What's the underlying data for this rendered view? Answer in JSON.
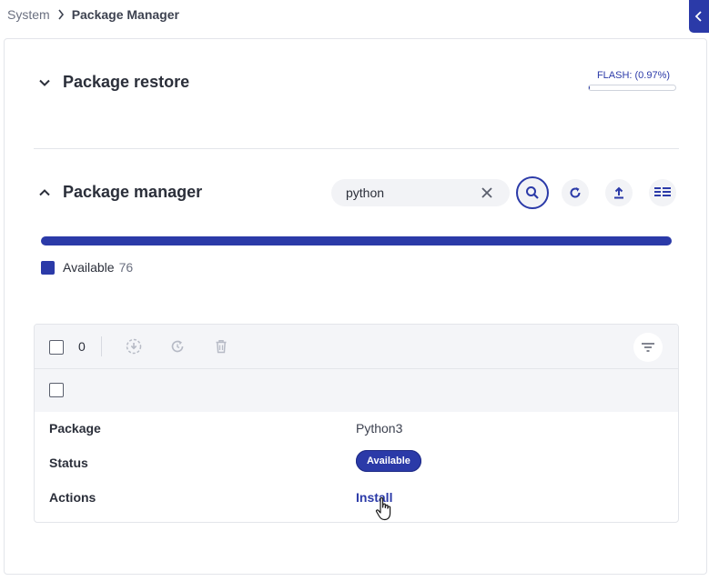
{
  "breadcrumb": {
    "root": "System",
    "current": "Package Manager"
  },
  "sections": {
    "restore": {
      "title": "Package restore"
    },
    "manager": {
      "title": "Package manager"
    }
  },
  "flash": {
    "label": "FLASH: (0.97%)",
    "percent": 0.97
  },
  "search": {
    "value": "python"
  },
  "legend": {
    "label": "Available",
    "count": "76"
  },
  "table": {
    "selected_count": "0",
    "rows": {
      "package": {
        "key": "Package",
        "value": "Python3"
      },
      "status": {
        "key": "Status",
        "value": "Available"
      },
      "actions": {
        "key": "Actions",
        "value": "Install"
      }
    }
  },
  "colors": {
    "accent": "#2b3aa8",
    "border": "#e3e5ea",
    "muted": "#6b7080"
  },
  "icons": [
    "chevron-right-icon",
    "collapse-left-icon",
    "chevron-down-icon",
    "chevron-up-icon",
    "close-icon",
    "search-icon",
    "refresh-icon",
    "upload-icon",
    "columns-icon",
    "download-install-icon",
    "update-icon",
    "trash-icon",
    "filter-icon",
    "hand-pointer-icon"
  ]
}
